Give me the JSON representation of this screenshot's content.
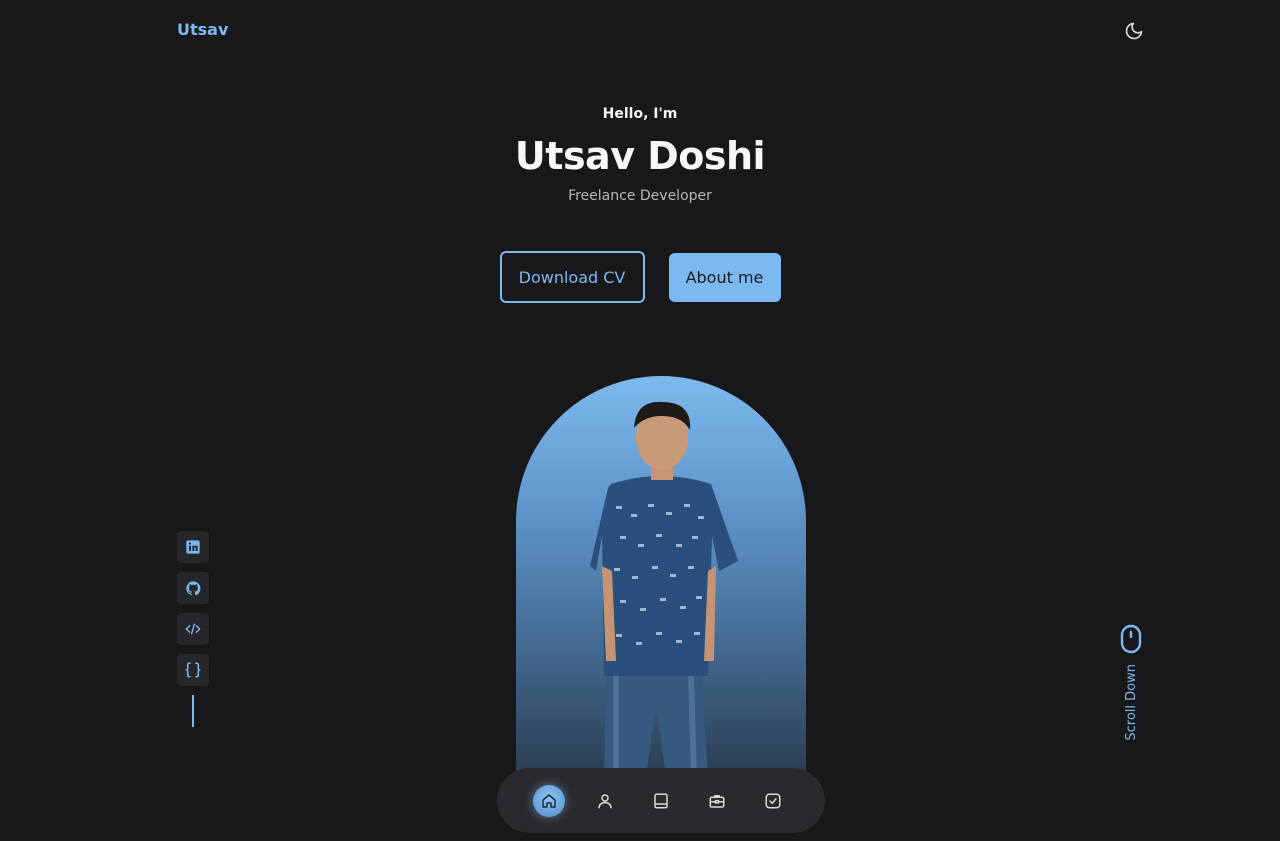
{
  "header": {
    "logo": "Utsav"
  },
  "hero": {
    "greeting": "Hello, I'm",
    "name": "Utsav Doshi",
    "role": "Freelance Developer"
  },
  "buttons": {
    "download_cv": "Download CV",
    "about_me": "About me"
  },
  "social": {
    "items": [
      {
        "icon": "linkedin-icon"
      },
      {
        "icon": "github-icon"
      },
      {
        "icon": "code-icon"
      },
      {
        "icon": "braces-icon"
      }
    ]
  },
  "scroll": {
    "label": "Scroll Down",
    "icon": "mouse-icon"
  },
  "bottom_nav": {
    "items": [
      {
        "icon": "home-icon",
        "active": true
      },
      {
        "icon": "user-icon",
        "active": false
      },
      {
        "icon": "book-icon",
        "active": false
      },
      {
        "icon": "briefcase-icon",
        "active": false
      },
      {
        "icon": "check-square-icon",
        "active": false
      }
    ]
  },
  "colors": {
    "background": "#18181b",
    "accent": "#7cb9f0",
    "surface": "#2a2a2e"
  }
}
